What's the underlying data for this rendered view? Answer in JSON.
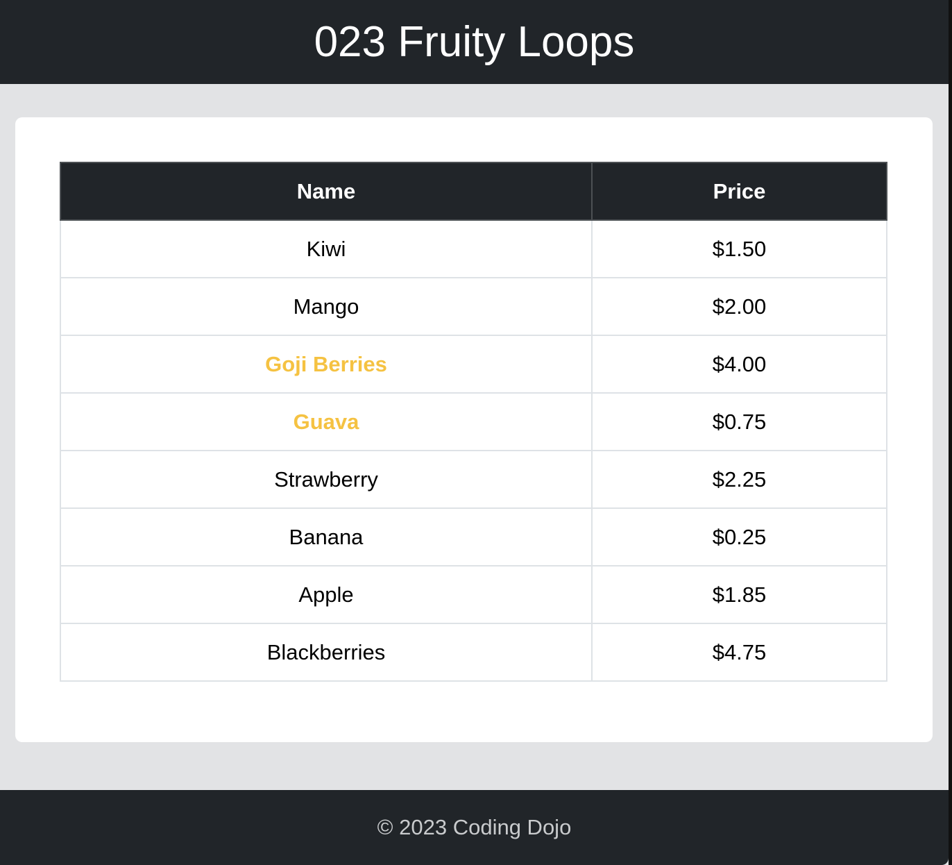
{
  "header": {
    "title": "023 Fruity Loops"
  },
  "table": {
    "columns": [
      "Name",
      "Price"
    ],
    "rows": [
      {
        "name": "Kiwi",
        "price": "$1.50",
        "highlight": false
      },
      {
        "name": "Mango",
        "price": "$2.00",
        "highlight": false
      },
      {
        "name": "Goji Berries",
        "price": "$4.00",
        "highlight": true
      },
      {
        "name": "Guava",
        "price": "$0.75",
        "highlight": true
      },
      {
        "name": "Strawberry",
        "price": "$2.25",
        "highlight": false
      },
      {
        "name": "Banana",
        "price": "$0.25",
        "highlight": false
      },
      {
        "name": "Apple",
        "price": "$1.85",
        "highlight": false
      },
      {
        "name": "Blackberries",
        "price": "$4.75",
        "highlight": false
      }
    ]
  },
  "colors": {
    "header_bg": "#212529",
    "highlight": "#f5c242",
    "page_bg": "#e2e3e5"
  },
  "footer": {
    "text": "© 2023 Coding Dojo"
  }
}
